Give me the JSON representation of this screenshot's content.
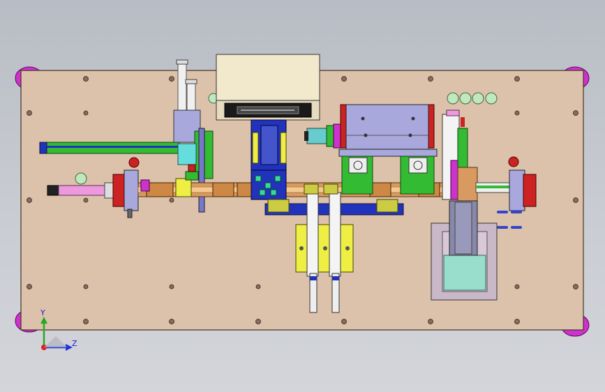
{
  "viewport": {
    "background_top": "#b8bcc4",
    "background_bottom": "#d3d5da"
  },
  "triad": {
    "y_label": "Y",
    "z_label": "Z",
    "y_color": "#22aa22",
    "z_color": "#2233dd",
    "x_color": "#dd2222"
  },
  "colors": {
    "base_plate": "#dcc2aa",
    "feet": "#cc33cc",
    "green": "#33bb33",
    "blue": "#2233bb",
    "yellow": "#eeee44",
    "light_blue": "#a8a8dd",
    "red": "#cc2222",
    "cream": "#f2e8cc",
    "pink": "#ee99dd",
    "teal": "#99ddcc"
  }
}
